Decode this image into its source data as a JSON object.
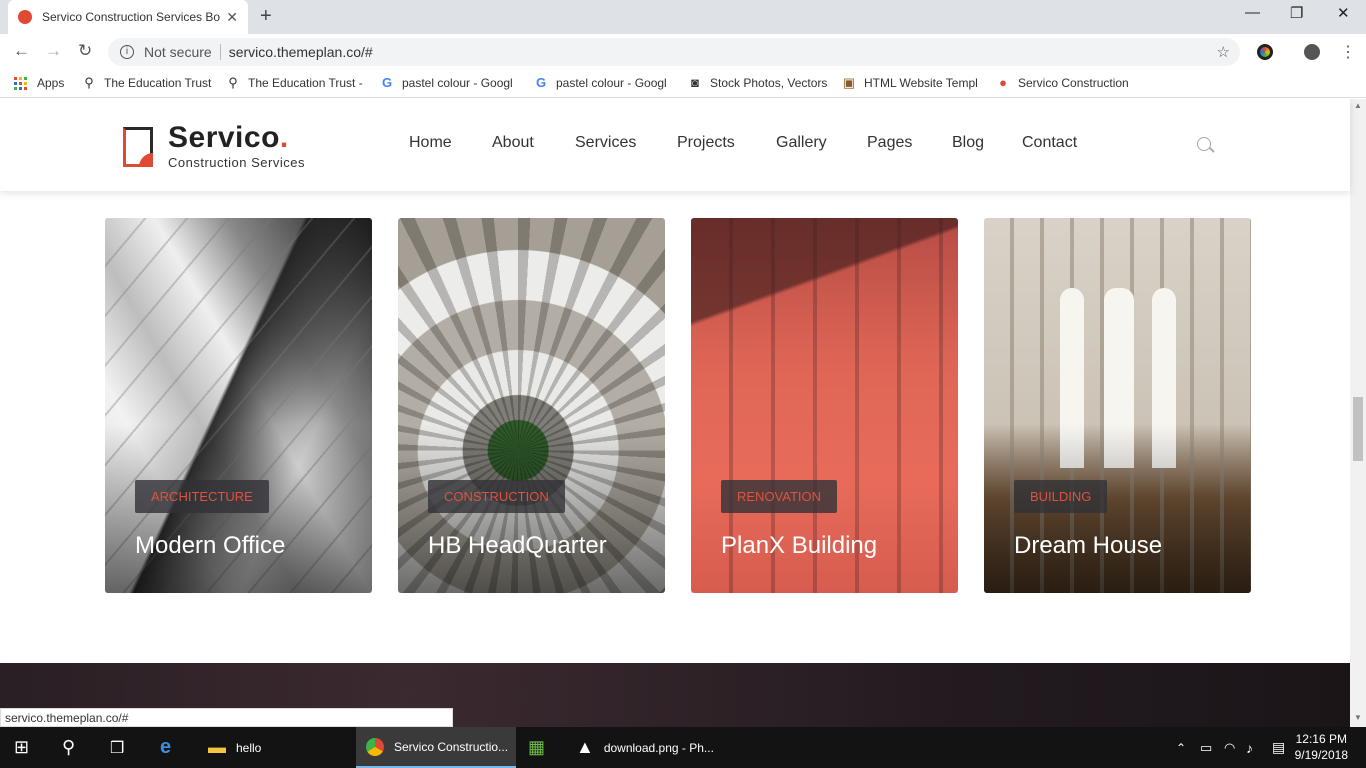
{
  "browser": {
    "tab_title": "Servico Construction Services Bo",
    "tab_close": "✕",
    "new_tab": "+",
    "window_controls": {
      "minimize": "—",
      "restore": "❐",
      "close": "✕"
    },
    "back": "←",
    "forward": "→",
    "reload": "↻",
    "info_icon": "i",
    "security_label": "Not secure",
    "url": "servico.themeplan.co/#",
    "star": "☆"
  },
  "bookmarks": [
    {
      "label": "Apps",
      "icon": "apps-grid-icon"
    },
    {
      "label": "The Education Trust",
      "icon": "tree-icon",
      "glyph": "⚲"
    },
    {
      "label": "The Education Trust -",
      "icon": "tree-icon",
      "glyph": "⚲"
    },
    {
      "label": "pastel colour - Googl",
      "icon": "google-icon",
      "glyph": "G"
    },
    {
      "label": "pastel colour - Googl",
      "icon": "google-icon",
      "glyph": "G"
    },
    {
      "label": "Stock Photos, Vectors",
      "icon": "camera-icon",
      "glyph": "◙"
    },
    {
      "label": "HTML Website Templ",
      "icon": "template-icon",
      "glyph": "▣"
    },
    {
      "label": "Servico Construction",
      "icon": "servico-favicon",
      "glyph": "●"
    }
  ],
  "site": {
    "logo_name": "Servico",
    "logo_period": ".",
    "logo_sub": "Construction Services",
    "nav": [
      "Home",
      "About",
      "Services",
      "Projects",
      "Gallery",
      "Pages",
      "Blog",
      "Contact"
    ]
  },
  "projects": [
    {
      "tag": "ARCHITECTURE",
      "title": "Modern Office"
    },
    {
      "tag": "CONSTRUCTION",
      "title": "HB HeadQuarter"
    },
    {
      "tag": "RENOVATION",
      "title": "PlanX Building"
    },
    {
      "tag": "BUILDING",
      "title": "Dream House"
    }
  ],
  "status_bar": "servico.themeplan.co/#",
  "taskbar": {
    "items": [
      {
        "label": "hello",
        "icon": "folder-icon"
      },
      {
        "label": "Servico Constructio...",
        "icon": "chrome-icon"
      },
      {
        "label": "",
        "icon": "spreadsheet-icon"
      },
      {
        "label": "download.png - Ph...",
        "icon": "photos-icon"
      }
    ],
    "time": "12:16 PM",
    "date": "9/19/2018"
  },
  "colors": {
    "accent": "#e04a35",
    "tab_bg": "#dee1e6",
    "taskbar": "#131313"
  }
}
